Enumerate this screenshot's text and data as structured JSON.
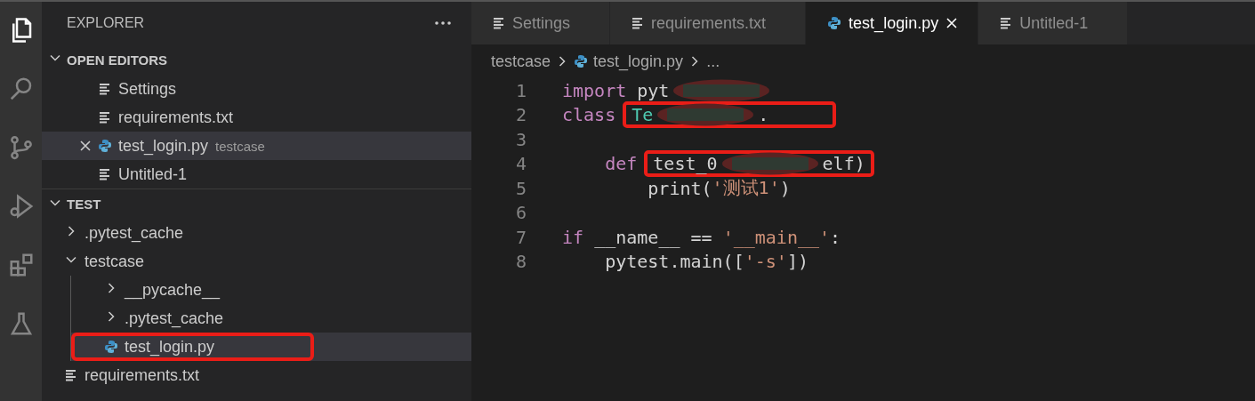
{
  "activity_bar": {
    "items": [
      {
        "kind": "files",
        "selected": true
      },
      {
        "kind": "search",
        "selected": false
      },
      {
        "kind": "source-control",
        "selected": false
      },
      {
        "kind": "run",
        "selected": false
      },
      {
        "kind": "extensions",
        "selected": false
      },
      {
        "kind": "testing",
        "selected": false
      }
    ]
  },
  "sidebar": {
    "title": "EXPLORER",
    "sections": [
      {
        "title": "OPEN EDITORS",
        "expanded": true,
        "items": [
          {
            "label": "Settings",
            "kind": "text",
            "selected": false
          },
          {
            "label": "requirements.txt",
            "kind": "text",
            "selected": false
          },
          {
            "label": "test_login.py",
            "kind": "python",
            "description": "testcase",
            "selected": true
          },
          {
            "label": "Untitled-1",
            "kind": "text",
            "selected": false
          }
        ]
      },
      {
        "title": "TEST",
        "expanded": true,
        "items": [
          {
            "label": ".pytest_cache",
            "kind": "folder",
            "expanded": false,
            "selected": false
          },
          {
            "label": "testcase",
            "kind": "folder",
            "expanded": true,
            "selected": false,
            "children": [
              {
                "label": "__pycache__",
                "kind": "folder",
                "expanded": false,
                "selected": false
              },
              {
                "label": ".pytest_cache",
                "kind": "folder",
                "expanded": false,
                "selected": false
              },
              {
                "label": "test_login.py",
                "kind": "python",
                "selected": true,
                "boxed": true
              }
            ]
          },
          {
            "label": "requirements.txt",
            "kind": "text",
            "selected": false
          }
        ]
      }
    ]
  },
  "tabs": [
    {
      "label": "Settings",
      "kind": "text",
      "selected": false
    },
    {
      "label": "requirements.txt",
      "kind": "text",
      "selected": false
    },
    {
      "label": "test_login.py",
      "kind": "python",
      "selected": true
    },
    {
      "label": "Untitled-1",
      "kind": "text",
      "selected": false
    }
  ],
  "breadcrumb": [
    {
      "label": "testcase",
      "kind": "folder"
    },
    {
      "label": "test_login.py",
      "kind": "python"
    },
    {
      "label": "...",
      "kind": "symbol"
    }
  ],
  "code": [
    {
      "number": "1",
      "tokens": [
        {
          "kind": "keyword",
          "text": "import"
        },
        {
          "kind": "plain",
          "text": " pyt"
        },
        {
          "kind": "redacted"
        }
      ]
    },
    {
      "number": "2",
      "tokens": [
        {
          "kind": "keyword",
          "text": "class"
        },
        {
          "kind": "group",
          "boxed": true,
          "children": [
            {
              "kind": "type",
              "text": "Te"
            },
            {
              "kind": "redacted"
            },
            {
              "kind": "plain",
              "text": "."
            }
          ]
        }
      ]
    },
    {
      "number": "3"
    },
    {
      "number": "4",
      "tokens": [
        {
          "kind": "keyword",
          "text": "    def"
        },
        {
          "kind": "group",
          "boxed": true,
          "children": [
            {
              "kind": "plain",
              "text": "test_0"
            },
            {
              "kind": "redacted"
            },
            {
              "kind": "plain",
              "text": "elf)"
            }
          ]
        }
      ]
    },
    {
      "number": "5",
      "tokens": [
        {
          "kind": "plain",
          "text": "        print("
        },
        {
          "kind": "string",
          "text": "'测试1'"
        },
        {
          "kind": "plain",
          "text": ")"
        }
      ]
    },
    {
      "number": "6"
    },
    {
      "number": "7",
      "tokens": [
        {
          "kind": "keyword",
          "text": "if"
        },
        {
          "kind": "plain",
          "text": " __name__ == "
        },
        {
          "kind": "string",
          "text": "'__main__'"
        },
        {
          "kind": "plain",
          "text": ":"
        }
      ]
    },
    {
      "number": "8",
      "tokens": [
        {
          "kind": "plain",
          "text": "    pytest.main(["
        },
        {
          "kind": "string",
          "text": "'-s'"
        },
        {
          "kind": "plain",
          "text": "])"
        }
      ]
    }
  ]
}
